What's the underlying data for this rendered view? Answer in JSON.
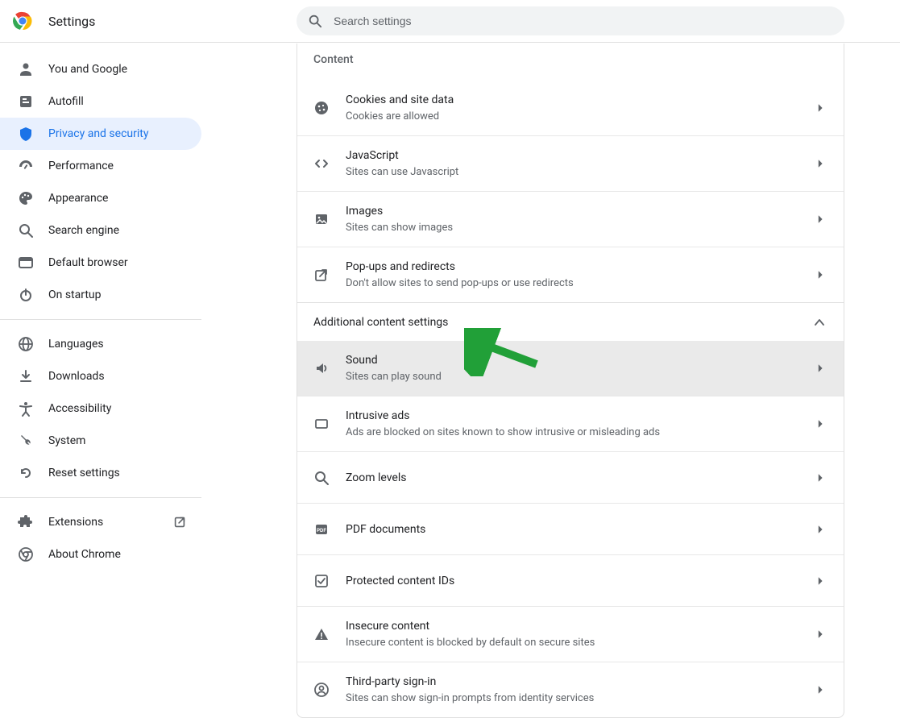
{
  "header": {
    "title": "Settings",
    "search_placeholder": "Search settings"
  },
  "sidebar": {
    "sections": [
      {
        "items": [
          {
            "icon": "person",
            "label": "You and Google"
          },
          {
            "icon": "autofill",
            "label": "Autofill"
          },
          {
            "icon": "shield",
            "label": "Privacy and security",
            "active": true
          },
          {
            "icon": "speed",
            "label": "Performance"
          },
          {
            "icon": "palette",
            "label": "Appearance"
          },
          {
            "icon": "search",
            "label": "Search engine"
          },
          {
            "icon": "browser",
            "label": "Default browser"
          },
          {
            "icon": "power",
            "label": "On startup"
          }
        ]
      },
      {
        "items": [
          {
            "icon": "globe",
            "label": "Languages"
          },
          {
            "icon": "download",
            "label": "Downloads"
          },
          {
            "icon": "accessibility",
            "label": "Accessibility"
          },
          {
            "icon": "wrench",
            "label": "System"
          },
          {
            "icon": "reset",
            "label": "Reset settings"
          }
        ]
      },
      {
        "items": [
          {
            "icon": "extension",
            "label": "Extensions",
            "trailing": "open-in-new"
          },
          {
            "icon": "chrome",
            "label": "About Chrome"
          }
        ]
      }
    ]
  },
  "main": {
    "content_section_title": "Content",
    "content_rows": [
      {
        "icon": "cookie",
        "title": "Cookies and site data",
        "sub": "Cookies are allowed"
      },
      {
        "icon": "code",
        "title": "JavaScript",
        "sub": "Sites can use Javascript"
      },
      {
        "icon": "image",
        "title": "Images",
        "sub": "Sites can show images"
      },
      {
        "icon": "popup",
        "title": "Pop-ups and redirects",
        "sub": "Don't allow sites to send pop-ups or use redirects"
      }
    ],
    "additional_label": "Additional content settings",
    "additional_rows": [
      {
        "icon": "sound",
        "title": "Sound",
        "sub": "Sites can play sound",
        "highlighted": true
      },
      {
        "icon": "ad",
        "title": "Intrusive ads",
        "sub": "Ads are blocked on sites known to show intrusive or misleading ads"
      },
      {
        "icon": "zoom",
        "title": "Zoom levels"
      },
      {
        "icon": "pdf",
        "title": "PDF documents"
      },
      {
        "icon": "protected",
        "title": "Protected content IDs"
      },
      {
        "icon": "warning",
        "title": "Insecure content",
        "sub": "Insecure content is blocked by default on secure sites"
      },
      {
        "icon": "account",
        "title": "Third-party sign-in",
        "sub": "Sites can show sign-in prompts from identity services"
      }
    ]
  }
}
